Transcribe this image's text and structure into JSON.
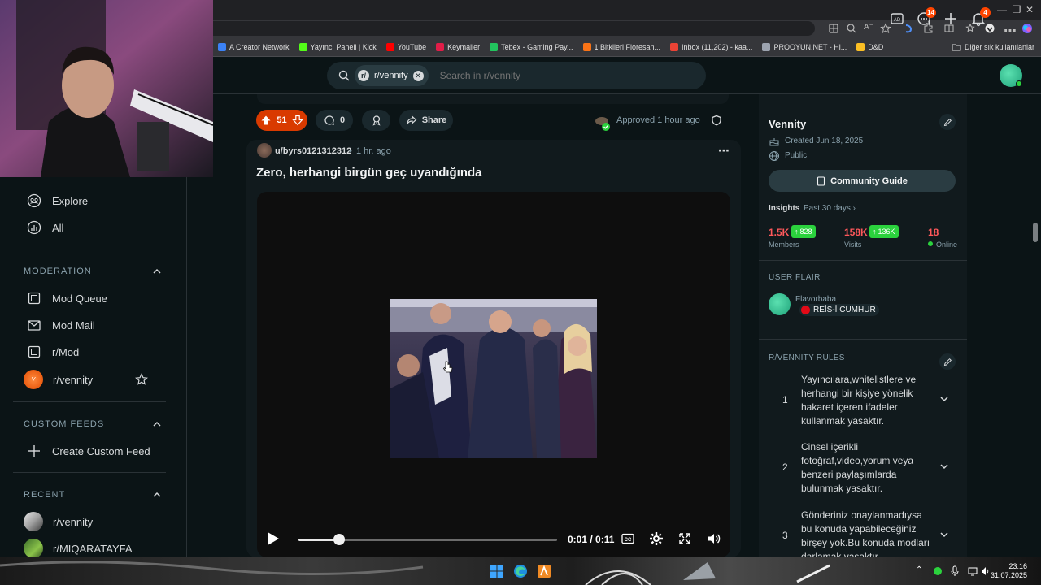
{
  "browser": {
    "bookmarks": [
      {
        "label": "A Creator Network",
        "color": "#3b82f6"
      },
      {
        "label": "Yayıncı Paneli | Kick",
        "color": "#53fc18"
      },
      {
        "label": "YouTube",
        "color": "#ff0000"
      },
      {
        "label": "Keymailer",
        "color": "#e11d48"
      },
      {
        "label": "Tebex - Gaming Pay...",
        "color": "#22c55e"
      },
      {
        "label": "1 Bitkileri Floresan...",
        "color": "#f97316"
      },
      {
        "label": "Inbox (11,202) - kaa...",
        "color": "#ea4335"
      },
      {
        "label": "PROOYUN.NET - Hi...",
        "color": "#9ca3af"
      },
      {
        "label": "D&D",
        "color": "#fbbf24"
      }
    ],
    "other_bookmarks": "Diğer sık kullanılanlar"
  },
  "header": {
    "search_chip": "r/vennity",
    "search_placeholder": "Search in r/vennity",
    "chat_badge": "14",
    "notif_badge": "4"
  },
  "sidebar": {
    "explore": "Explore",
    "all": "All",
    "moderation_title": "MODERATION",
    "mod_queue": "Mod Queue",
    "mod_mail": "Mod Mail",
    "r_mod": "r/Mod",
    "r_vennity": "r/vennity",
    "custom_feeds_title": "CUSTOM FEEDS",
    "create_feed": "Create Custom Feed",
    "recent_title": "RECENT",
    "recent": [
      "r/vennity",
      "r/MIQARATAYFA"
    ]
  },
  "post_actions": {
    "votes": "51",
    "comments": "0",
    "share": "Share",
    "approved": "Approved 1 hour ago"
  },
  "post": {
    "author": "u/byrs0121312312",
    "time": "1 hr. ago",
    "title": "Zero, herhangi birgün geç uyandığında",
    "video_time": "0:01 / 0:11",
    "progress": 0.1
  },
  "community": {
    "name": "Vennity",
    "created": "Created Jun 18, 2025",
    "visibility": "Public",
    "guide_btn": "Community Guide",
    "insights": "Insights",
    "insights_range": "Past 30 days",
    "members": "1.5K",
    "members_up": "828",
    "members_label": "Members",
    "visits": "158K",
    "visits_up": "136K",
    "visits_label": "Visits",
    "online": "18",
    "online_label": "Online",
    "user_flair_title": "USER FLAIR",
    "flair_user": "Flavorbaba",
    "flair_text": "REİS-İ CUMHUR",
    "rules_title": "R/VENNITY RULES",
    "rules": [
      {
        "num": "1",
        "text": "Yayıncılara,whitelistlere ve herhangi bir kişiye yönelik hakaret içeren ifadeler kullanmak yasaktır."
      },
      {
        "num": "2",
        "text": "Cinsel içerikli fotoğraf,video,yorum veya benzeri paylaşımlarda bulunmak yasaktır."
      },
      {
        "num": "3",
        "text": "Gönderiniz onaylanmadıysa bu konuda yapabileceğiniz birşey yok.Bu konuda modları darlamak yasaktır."
      }
    ]
  },
  "taskbar": {
    "time": "23:16",
    "date": "31.07.2025"
  },
  "colors": {
    "bg": "#0b1416",
    "card": "#111a1d",
    "upvote": "#d93a00",
    "accent_red": "#ff585b",
    "accent_green": "#2bd23d"
  }
}
